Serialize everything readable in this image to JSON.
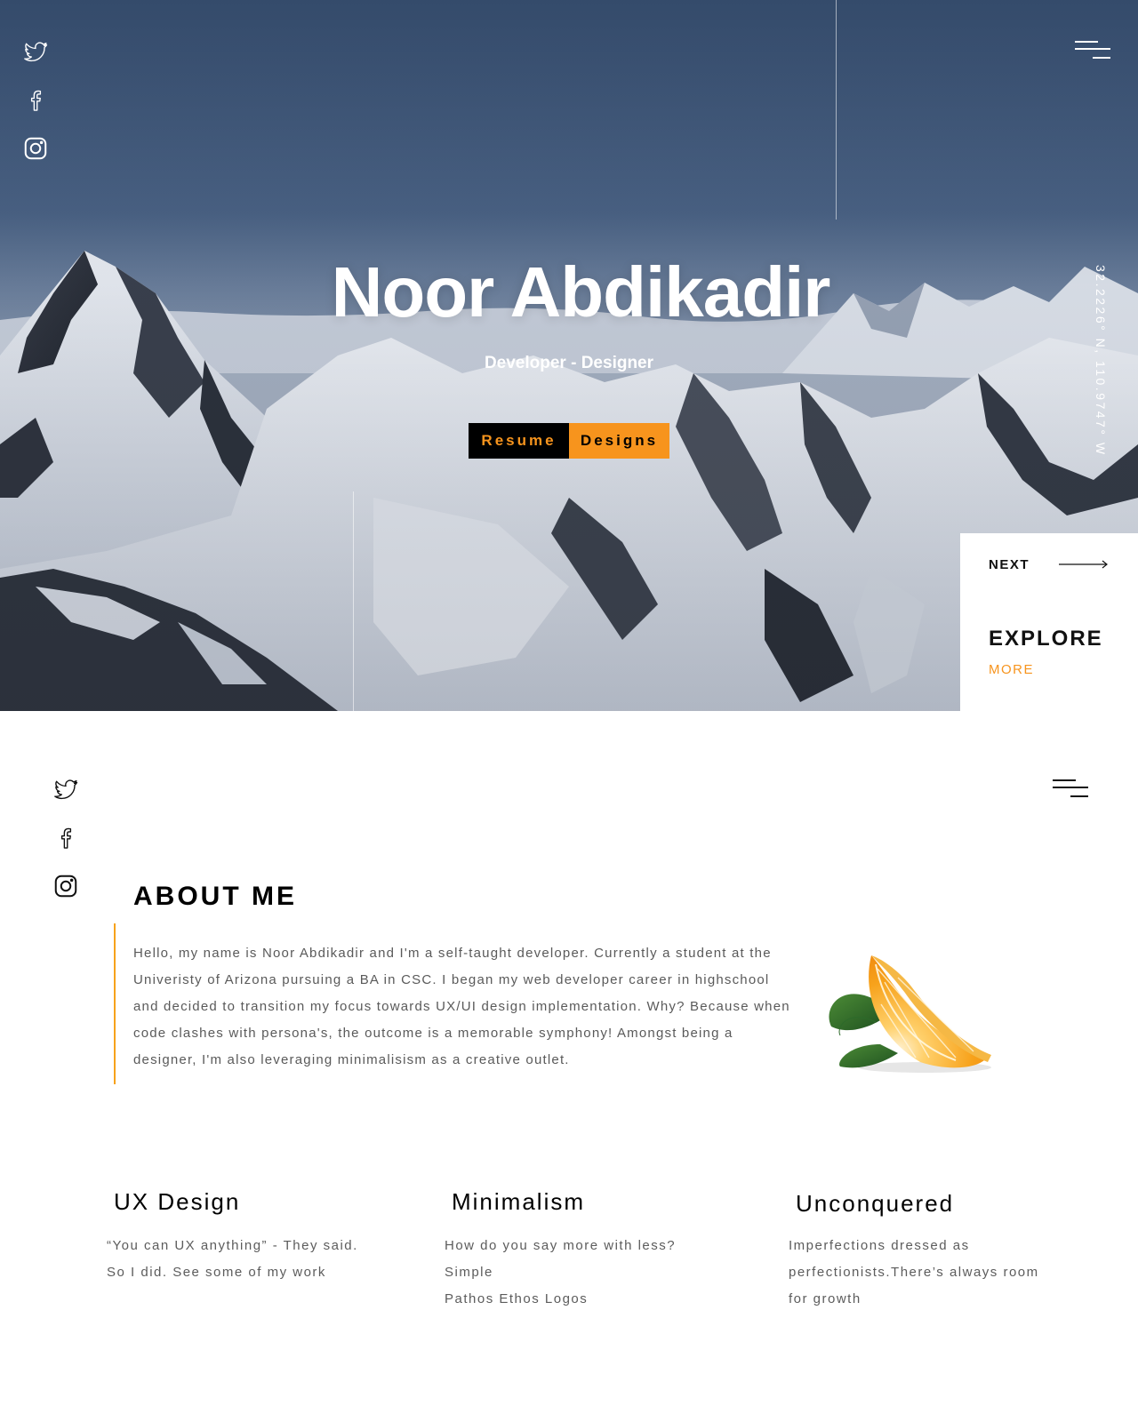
{
  "hero": {
    "title": "Noor Abdikadir",
    "subtitle": "Developer - Designer",
    "coordinates": "32.2226° N, 110.9747° W",
    "buttons": {
      "resume": "Resume",
      "designs": "Designs"
    },
    "next_label": "NEXT",
    "explore_label": "EXPLORE",
    "more_label": "MORE",
    "social_icons": [
      "twitter-icon",
      "facebook-icon",
      "instagram-icon"
    ],
    "menu_icon": "hamburger-menu-icon"
  },
  "about": {
    "title": "ABOUT ME",
    "paragraph": "Hello, my name is Noor Abdikadir and I'm a self-taught developer. Currently a student at the Univeristy of Arizona pursuing a BA in CSC. I began my web developer career in highschool and decided to transition my focus towards UX/UI design implementation. Why? Because when code clashes with persona's, the outcome is a memorable symphony! Amongst being a designer, I'm also leveraging minimalisism as a creative outlet.",
    "image": "orange-slice-image",
    "social_icons": [
      "twitter-icon",
      "facebook-icon",
      "instagram-icon"
    ],
    "menu_icon": "hamburger-menu-icon"
  },
  "features": [
    {
      "title": "UX Design",
      "text": " “You can UX anything” - They said. So I did. See some of my work"
    },
    {
      "title": "Minimalism",
      "text": "How do you say more with less? Simple",
      "text2": "Pathos Ethos Logos"
    },
    {
      "title": "Unconquered",
      "text": "Imperfections dressed as perfectionists.There’s always room for growth"
    }
  ],
  "colors": {
    "accent": "#f7941d",
    "hero_sky": "#3e5677",
    "text_body": "#5a5a5a",
    "black": "#000000",
    "white": "#ffffff"
  }
}
